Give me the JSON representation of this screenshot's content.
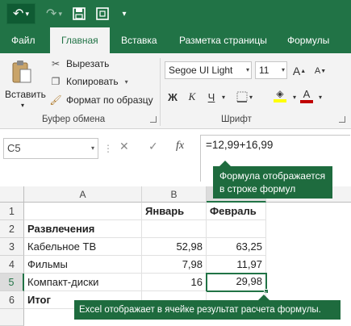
{
  "quick_access": {
    "undo_icon": "undo-icon",
    "redo_icon": "redo-icon",
    "save_icon": "save-icon",
    "frame_icon": "screen-frame-icon",
    "customize_icon": "customize-dropdown-icon"
  },
  "tabs": [
    "Файл",
    "Главная",
    "Вставка",
    "Разметка страницы",
    "Формулы"
  ],
  "active_tab": "Главная",
  "ribbon": {
    "paste_label": "Вставить",
    "cut_label": "Вырезать",
    "copy_label": "Копировать",
    "format_painter_label": "Формат по образцу",
    "clipboard_group_label": "Буфер обмена",
    "font_name": "Segoe UI Light",
    "font_size": "11",
    "bold_label": "Ж",
    "italic_label": "К",
    "underline_label": "Ч",
    "font_group_label": "Шрифт",
    "grow_font_label": "A",
    "shrink_font_label": "A",
    "font_color_label": "A",
    "font_color": "#c00000",
    "highlight_color": "#ffff00"
  },
  "formula_bar": {
    "name_box": "C5",
    "fx_label": "fx",
    "formula": "=12,99+16,99"
  },
  "grid": {
    "columns": [
      "A",
      "B",
      "C"
    ],
    "selected_column": "C",
    "rows": [
      {
        "num": "1",
        "a": "",
        "b": "Январь",
        "c": "Февраль"
      },
      {
        "num": "2",
        "a": "Развлечения",
        "b": "",
        "c": ""
      },
      {
        "num": "3",
        "a": "Кабельное ТВ",
        "b": "52,98",
        "c": "63,25"
      },
      {
        "num": "4",
        "a": "Фильмы",
        "b": "7,98",
        "c": "11,97"
      },
      {
        "num": "5",
        "a": "Компакт-диски",
        "b": "16",
        "c": "29,98"
      },
      {
        "num": "6",
        "a": "Итог",
        "b": "",
        "c": ""
      }
    ],
    "selected_row": "5"
  },
  "callouts": {
    "formula_bar_note": "Формула отображается в строке формул",
    "cell_result_note": "Excel отображает в ячейке результат расчета формулы."
  },
  "colors": {
    "accent": "#217346",
    "callout_bg": "#1e6b3e"
  }
}
